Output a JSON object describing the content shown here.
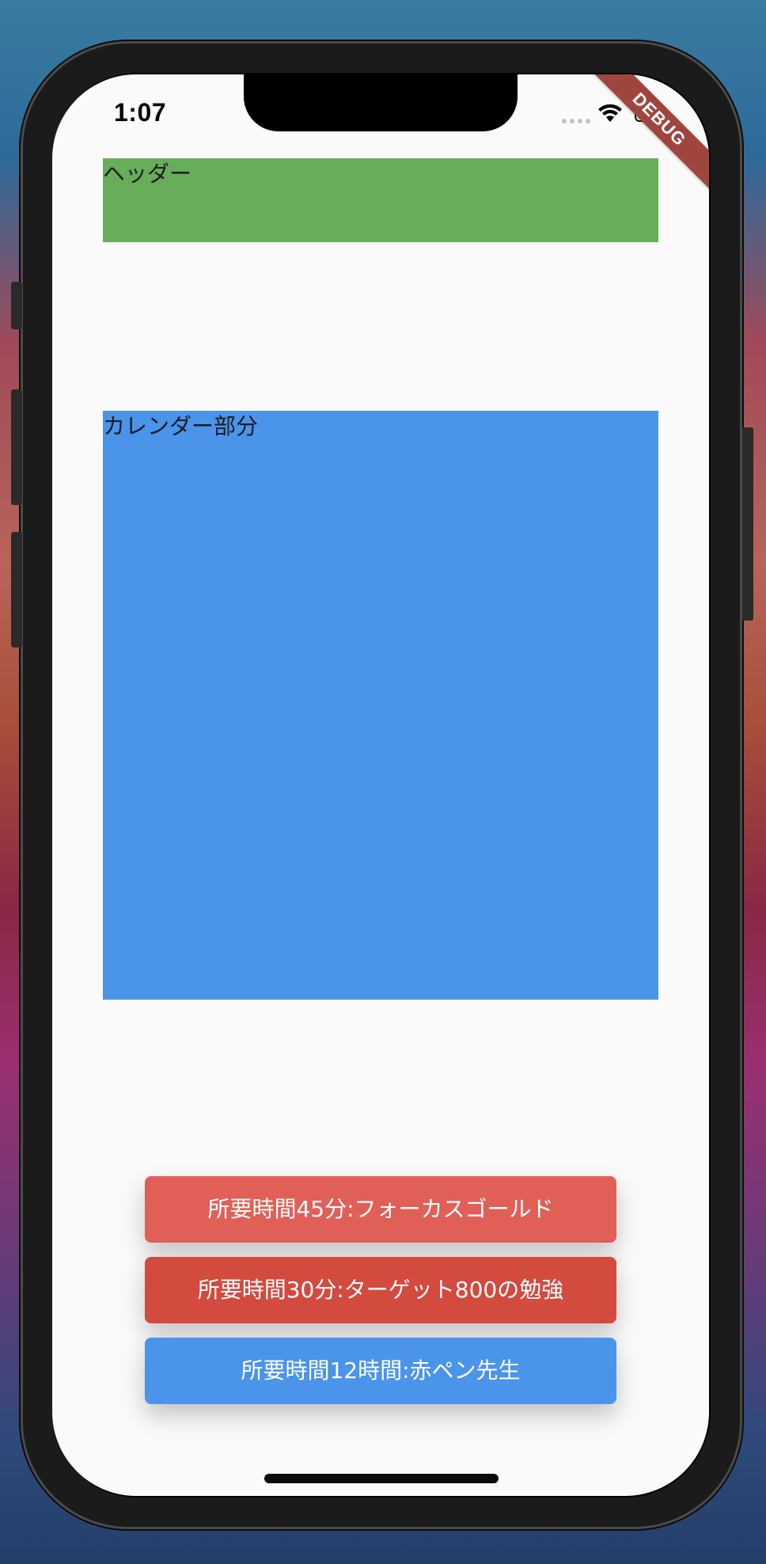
{
  "status_bar": {
    "time": "1:07",
    "debug_badge": "DEBUG"
  },
  "header": {
    "label": "ヘッダー",
    "color": "#68ad5a"
  },
  "calendar": {
    "label": "カレンダー部分",
    "color": "#4a94ea"
  },
  "actions": [
    {
      "label": "所要時間45分:フォーカスゴールド",
      "color": "#e06058"
    },
    {
      "label": "所要時間30分:ターゲット800の勉強",
      "color": "#d34a3f"
    },
    {
      "label": "所要時間12時間:赤ペン先生",
      "color": "#4a94ea"
    }
  ]
}
